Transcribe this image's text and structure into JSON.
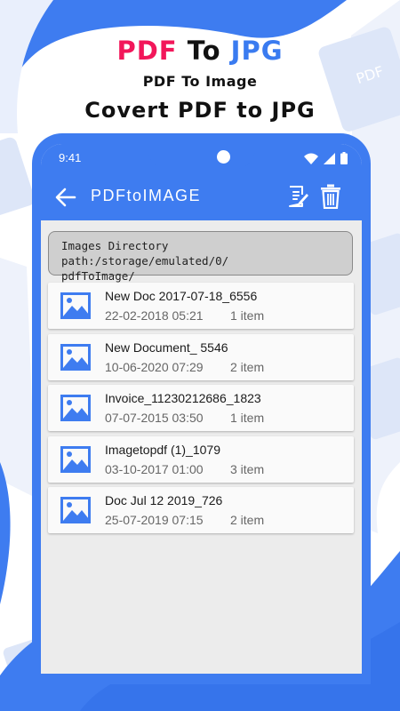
{
  "promo": {
    "title_part1": "PDF",
    "title_part2": "To",
    "title_part3": "JPG",
    "subtitle": "PDF To Image",
    "headline": "Covert PDF to JPG",
    "bg_doc_label": "PDF"
  },
  "status_bar": {
    "time": "9:41"
  },
  "app_bar": {
    "title": "PDFtoIMAGE"
  },
  "directory": {
    "line1": "Images Directory path:/storage/emulated/0/",
    "line2": "pdfToImage/"
  },
  "folders": [
    {
      "name": "New Doc 2017-07-18_6556",
      "date": "22-02-2018 05:21",
      "count": "1  item"
    },
    {
      "name": "New Document_ 5546",
      "date": "10-06-2020 07:29",
      "count": "2  item"
    },
    {
      "name": "Invoice_11230212686_1823",
      "date": "07-07-2015 03:50",
      "count": "1  item"
    },
    {
      "name": "Imagetopdf (1)_1079",
      "date": "03-10-2017 01:00",
      "count": "3  item"
    },
    {
      "name": "Doc Jul 12 2019_726",
      "date": "25-07-2019 07:15",
      "count": "2  item"
    }
  ],
  "colors": {
    "accent": "#3e7cf0",
    "title_red": "#f2175a",
    "title_blue": "#3a7bf0"
  }
}
